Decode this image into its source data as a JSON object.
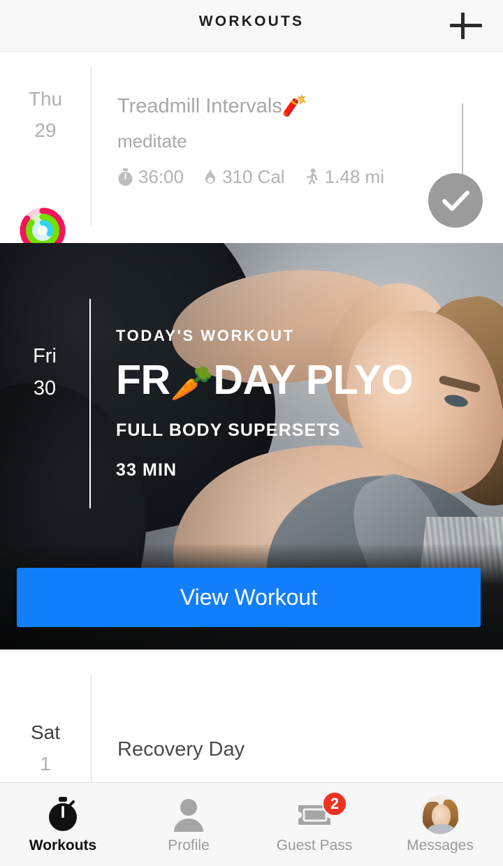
{
  "header": {
    "title": "WORKOUTS",
    "add_icon": "plus-icon"
  },
  "days": [
    {
      "dow": "Thu",
      "date": "29",
      "state": "completed",
      "workout_title": "Treadmill Intervals",
      "workout_emoji": "🧨",
      "workout_subtitle": "meditate",
      "stats": [
        {
          "icon": "stopwatch-icon",
          "glyph": "⏱",
          "value": "36:00"
        },
        {
          "icon": "flame-icon",
          "glyph": "🔥",
          "value": "310 Cal"
        },
        {
          "icon": "runner-icon",
          "glyph": "🚶",
          "value": "1.48 mi"
        }
      ],
      "completed_icon": "check-icon",
      "rings": {
        "move": "#f5145a",
        "exercise": "#6fe000",
        "stand": "#30d2f2"
      }
    },
    {
      "dow": "Fri",
      "date": "30",
      "state": "today",
      "eyebrow": "TODAY'S WORKOUT",
      "headline_before": "FR",
      "headline_emoji": "🥕",
      "headline_after": "DAY PLYO",
      "meta1": "FULL BODY SUPERSETS",
      "meta2": "33 MIN",
      "cta_label": "View Workout",
      "cta_color": "#127efb"
    },
    {
      "dow": "Sat",
      "date": "1",
      "state": "upcoming",
      "workout_title": "Recovery Day"
    }
  ],
  "tabbar": {
    "items": [
      {
        "label": "Workouts",
        "icon": "stopwatch-icon",
        "active": true
      },
      {
        "label": "Profile",
        "icon": "person-icon",
        "active": false
      },
      {
        "label": "Guest Pass",
        "icon": "ticket-icon",
        "active": false,
        "badge": "2",
        "badge_color": "#ef3124"
      },
      {
        "label": "Messages",
        "icon": "avatar-icon",
        "active": false
      }
    ]
  }
}
